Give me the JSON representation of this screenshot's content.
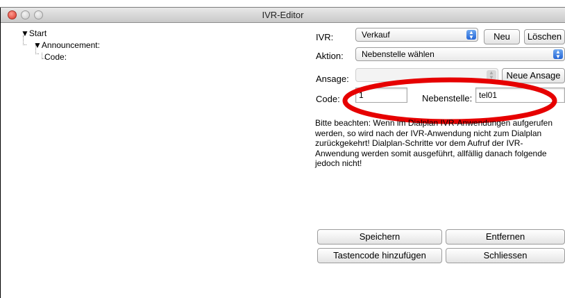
{
  "window": {
    "title": "IVR-Editor"
  },
  "tree": {
    "start": "Start",
    "announcement": "Announcement:",
    "code": "Code:"
  },
  "form": {
    "ivr_label": "IVR:",
    "ivr_value": "Verkauf",
    "neu_button": "Neu",
    "loeschen_button": "Löschen",
    "aktion_label": "Aktion:",
    "aktion_value": "Nebenstelle wählen",
    "ansage_label": "Ansage:",
    "ansage_value": "",
    "neue_ansage_button": "Neue Ansage",
    "code_label": "Code:",
    "code_value": "1",
    "nebenstelle_label": "Nebenstelle:",
    "nebenstelle_value": "tel01"
  },
  "note_text": "Bitte beachten: Wenn im Dialplan IVR-Anwendungen aufgerufen werden, so wird nach der IVR-Anwendung nicht zum Dialplan zurückgekehrt! Dialplan-Schritte vor dem Aufruf der IVR-Anwendung werden somit ausgeführt, allfällig danach folgende jedoch nicht!",
  "buttons": {
    "speichern": "Speichern",
    "entfernen": "Entfernen",
    "tastencode": "Tastencode hinzufügen",
    "schliessen": "Schliessen"
  },
  "colors": {
    "annotation": "#e60000",
    "selection": "#c5d8f5",
    "close_button": "#d7352a"
  }
}
